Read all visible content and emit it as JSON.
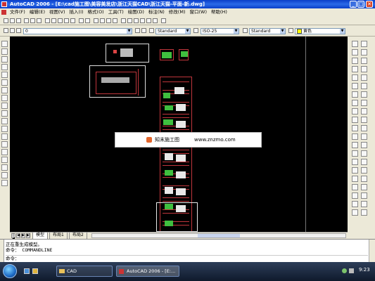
{
  "window": {
    "title": "AutoCAD 2006 - [E:\\cad施工图\\美容美发店\\浙江天猫CAD\\浙江天猫-平面-新.dwg]",
    "min": "_",
    "max": "□",
    "close": "✕"
  },
  "menu": [
    "文件(F)",
    "编辑(E)",
    "视图(V)",
    "插入(I)",
    "格式(O)",
    "工具(T)",
    "绘图(D)",
    "标注(N)",
    "修改(M)",
    "窗口(W)",
    "帮助(H)"
  ],
  "toolbar": {
    "layer_value": "0",
    "text_style": "Standard",
    "dim_style": "ISO-25",
    "table_style": "Standard",
    "color": "黄色"
  },
  "tabs": {
    "model": "模型",
    "layout1": "布局1",
    "layout2": "布局2"
  },
  "banner": {
    "brand": "知末施工图",
    "url": "www.znzmo.com"
  },
  "command": {
    "line1": "正在重生成模型。",
    "line2": "命令： COMMANDLINE",
    "prompt": "命令："
  },
  "taskbar": {
    "folder": "CAD",
    "app": "AutoCAD 2006 - [E:...",
    "clock": "9:23"
  }
}
